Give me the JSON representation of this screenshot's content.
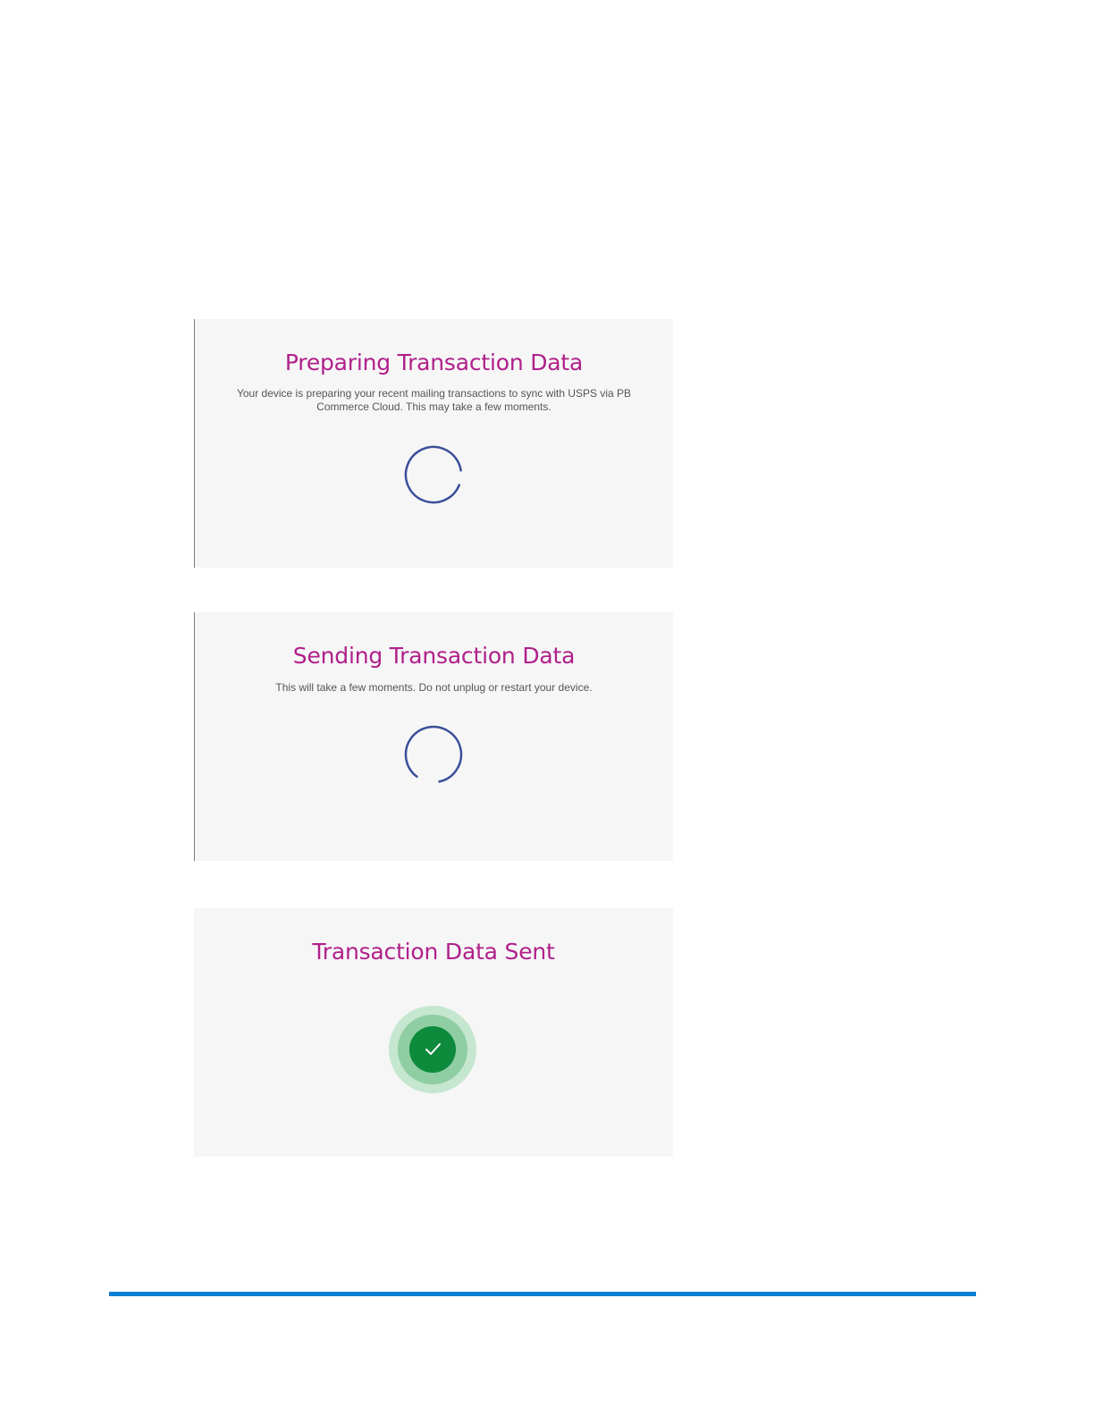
{
  "panels": {
    "preparing": {
      "title": "Preparing Transaction Data",
      "description": "Your device is preparing your recent mailing transactions to sync with USPS via PB Commerce Cloud. This may take a few moments.",
      "icon": "loading-spinner-icon"
    },
    "sending": {
      "title": "Sending Transaction Data",
      "description": "This will take a few moments. Do not unplug or restart your device.",
      "icon": "loading-spinner-icon"
    },
    "sent": {
      "title": "Transaction Data Sent",
      "icon": "checkmark-success-icon"
    }
  },
  "colors": {
    "title": "#b0208b",
    "spinner": "#3a4f9a",
    "success": "#0e8a3c",
    "footer_rule": "#0b7fd4",
    "panel_background": "#f6f6f6"
  }
}
